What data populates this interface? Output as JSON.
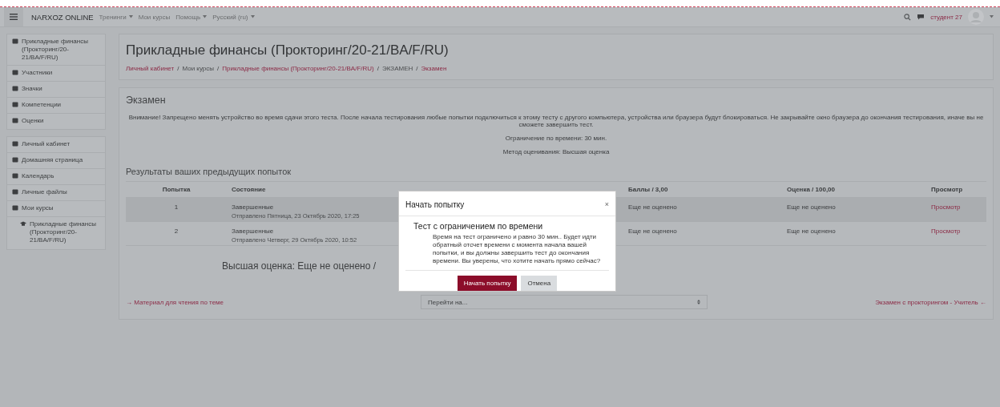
{
  "navbar": {
    "brand": "NARXOZ ONLINE",
    "menu": [
      {
        "label": "Тренинги",
        "has_menu": true
      },
      {
        "label": "Мои курсы",
        "has_menu": false
      },
      {
        "label": "Помощь",
        "has_menu": true
      },
      {
        "label": "Русский (ru)",
        "has_menu": true
      }
    ],
    "user": "студент 27"
  },
  "sidebar": {
    "sections": [
      {
        "items": [
          {
            "label": "Прикладные финансы (Прокторинг/20-21/BA/F/RU)"
          },
          {
            "label": "Участники"
          },
          {
            "label": "Значки"
          },
          {
            "label": "Компетенции"
          },
          {
            "label": "Оценки"
          }
        ]
      },
      {
        "items": [
          {
            "label": "Личный кабинет"
          },
          {
            "label": "Домашняя страница"
          },
          {
            "label": "Календарь"
          },
          {
            "label": "Личные файлы"
          },
          {
            "label": "Мои курсы",
            "children": [
              {
                "label": "Прикладные финансы (Прокторинг/20-21/BA/F/RU)"
              }
            ]
          }
        ]
      }
    ]
  },
  "header": {
    "title": "Прикладные финансы (Прокторинг/20-21/BA/F/RU)",
    "separator": "/",
    "breadcrumb": [
      {
        "label": "Личный кабинет",
        "link": true
      },
      {
        "label": "Мои курсы",
        "link": false
      },
      {
        "label": "Прикладные финансы (Прокторинг/20-21/BA/F/RU)",
        "link": true
      },
      {
        "label": "ЭКЗАМЕН",
        "link": false
      },
      {
        "label": "Экзамен",
        "link": true
      }
    ]
  },
  "quiz": {
    "title": "Экзамен",
    "info": [
      "Внимание! Запрещено менять устройство во время сдачи этого теста. После начала тестирования любые попытки подключиться к этому тесту с другого компьютера, устройства или браузера будут блокироваться. Не закрывайте окно браузера до окончания тестирования, иначе вы не сможете завершить тест.",
      "Ограничение по времени: 30 мин.",
      "Метод оценивания: Высшая оценка"
    ],
    "results_title": "Результаты ваших предыдущих попыток",
    "table": {
      "columns": [
        "Попытка",
        "Состояние",
        "Баллы / 3,00",
        "Оценка / 100,00",
        "Просмотр"
      ],
      "rows": [
        {
          "attempt": "1",
          "state": "Завершенные",
          "submitted": "Отправлено Пятница, 23 Октябрь 2020, 17:25",
          "marks": "Еще не оценено",
          "grade": "Еще не оценено",
          "review": "Просмотр"
        },
        {
          "attempt": "2",
          "state": "Завершенные",
          "submitted": "Отправлено Четверг, 29 Октябрь 2020, 10:52",
          "marks": "Еще не оценено",
          "grade": "Еще не оценено",
          "review": "Просмотр"
        }
      ]
    },
    "highest_grade": "Высшая оценка: Еще не оценено /",
    "prev_link": "→ Материал для чтения по теме",
    "jump_select": "Перейти на...",
    "next_link": "Экзамен с прокторингом - Учитель ←"
  },
  "modal": {
    "title": "Начать попытку",
    "close": "×",
    "heading": "Тест с ограничением по времени",
    "text": "Время на тест ограничено и равно 30 мин.. Будет идти обратный отсчет времени с момента начала вашей попытки, и вы должны завершить тест до окончания времени. Вы уверены, что хотите начать прямо сейчас?",
    "buttons": [
      {
        "label": "Начать попытку",
        "kind": "primary"
      },
      {
        "label": "Отмена",
        "kind": "secondary"
      }
    ]
  }
}
